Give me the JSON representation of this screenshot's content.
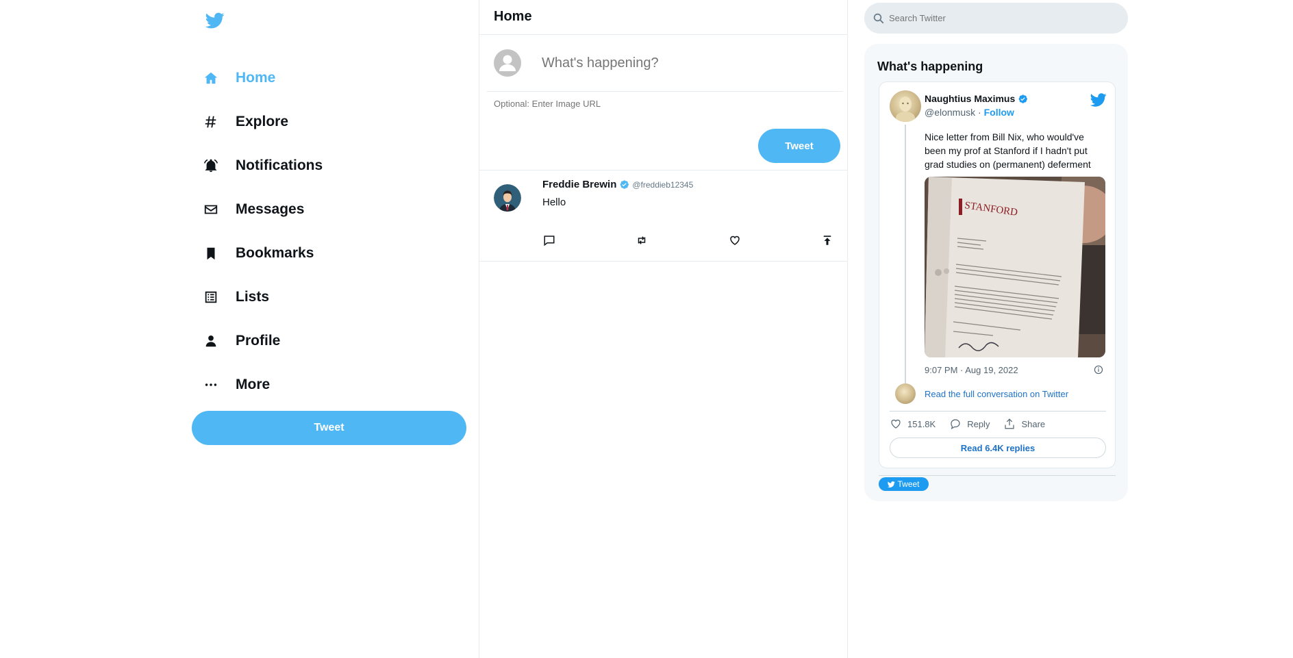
{
  "sidebar": {
    "items": [
      {
        "label": "Home",
        "icon": "home-icon",
        "active": true
      },
      {
        "label": "Explore",
        "icon": "hash-icon"
      },
      {
        "label": "Notifications",
        "icon": "bell-icon"
      },
      {
        "label": "Messages",
        "icon": "mail-icon"
      },
      {
        "label": "Bookmarks",
        "icon": "bookmark-icon"
      },
      {
        "label": "Lists",
        "icon": "list-icon"
      },
      {
        "label": "Profile",
        "icon": "person-icon"
      },
      {
        "label": "More",
        "icon": "more-icon"
      }
    ],
    "tweet_label": "Tweet"
  },
  "feed": {
    "title": "Home",
    "composer": {
      "placeholder": "What's happening?",
      "image_placeholder": "Optional: Enter Image URL",
      "tweet_label": "Tweet"
    },
    "posts": [
      {
        "name": "Freddie Brewin",
        "handle": "@freddieb12345",
        "text": "Hello",
        "verified": true
      }
    ]
  },
  "search": {
    "placeholder": "Search Twitter"
  },
  "widget": {
    "title": "What's happening",
    "embed": {
      "name": "Naughtius Maximus",
      "handle": "@elonmusk",
      "separator": "·",
      "follow": "Follow",
      "text": "Nice letter from Bill Nix, who would've been my prof at Stanford if I hadn't put grad studies on (permanent) deferment",
      "timestamp": "9:07 PM · Aug 19, 2022",
      "read_conversation": "Read the full conversation on Twitter",
      "likes": "151.8K",
      "reply": "Reply",
      "share": "Share",
      "read_replies": "Read 6.4K replies",
      "photo_text": "STANFORD"
    },
    "tweet_button": "Tweet"
  },
  "colors": {
    "accent": "#50b7f5",
    "twitter_blue": "#1d9bf0",
    "border": "#e6ecf0"
  }
}
